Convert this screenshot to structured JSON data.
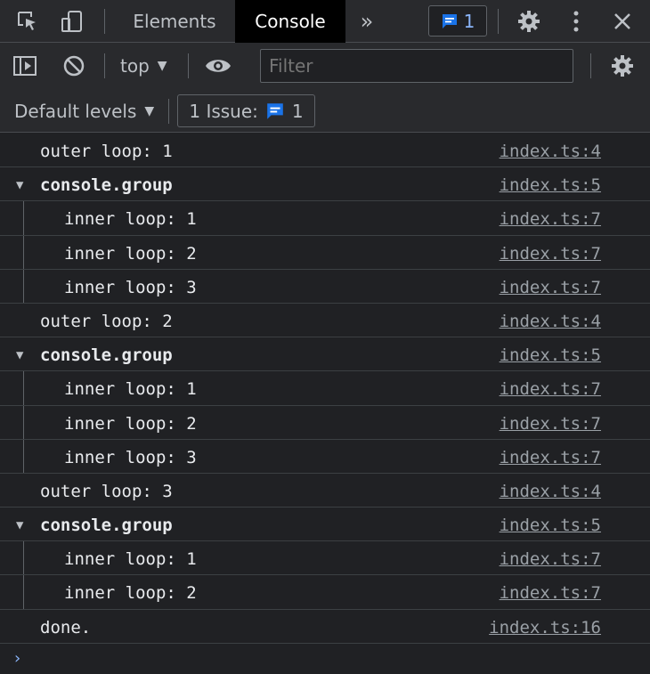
{
  "tabs": {
    "elements": "Elements",
    "console": "Console",
    "more": "»",
    "issue_count": "1"
  },
  "toolbar": {
    "context": "top",
    "filter_placeholder": "Filter"
  },
  "levels": {
    "label": "Default levels",
    "issues_label": "1 Issue:",
    "issues_count": "1"
  },
  "rows": [
    {
      "type": "log",
      "indent": false,
      "text": "outer loop: 1",
      "src": "index.ts:4"
    },
    {
      "type": "group",
      "indent": false,
      "text": "console.group",
      "src": "index.ts:5"
    },
    {
      "type": "log",
      "indent": true,
      "text": "inner loop: 1",
      "src": "index.ts:7"
    },
    {
      "type": "log",
      "indent": true,
      "text": "inner loop: 2",
      "src": "index.ts:7"
    },
    {
      "type": "log",
      "indent": true,
      "text": "inner loop: 3",
      "src": "index.ts:7"
    },
    {
      "type": "log",
      "indent": false,
      "text": "outer loop: 2",
      "src": "index.ts:4"
    },
    {
      "type": "group",
      "indent": false,
      "text": "console.group",
      "src": "index.ts:5"
    },
    {
      "type": "log",
      "indent": true,
      "text": "inner loop: 1",
      "src": "index.ts:7"
    },
    {
      "type": "log",
      "indent": true,
      "text": "inner loop: 2",
      "src": "index.ts:7"
    },
    {
      "type": "log",
      "indent": true,
      "text": "inner loop: 3",
      "src": "index.ts:7"
    },
    {
      "type": "log",
      "indent": false,
      "text": "outer loop: 3",
      "src": "index.ts:4"
    },
    {
      "type": "group",
      "indent": false,
      "text": "console.group",
      "src": "index.ts:5"
    },
    {
      "type": "log",
      "indent": true,
      "text": "inner loop: 1",
      "src": "index.ts:7"
    },
    {
      "type": "log",
      "indent": true,
      "text": "inner loop: 2",
      "src": "index.ts:7"
    },
    {
      "type": "log",
      "indent": false,
      "text": "done.",
      "src": "index.ts:16"
    }
  ],
  "prompt_symbol": "›",
  "colors": {
    "accent": "#8ab4f8",
    "issue_icon": "#1a73e8"
  }
}
